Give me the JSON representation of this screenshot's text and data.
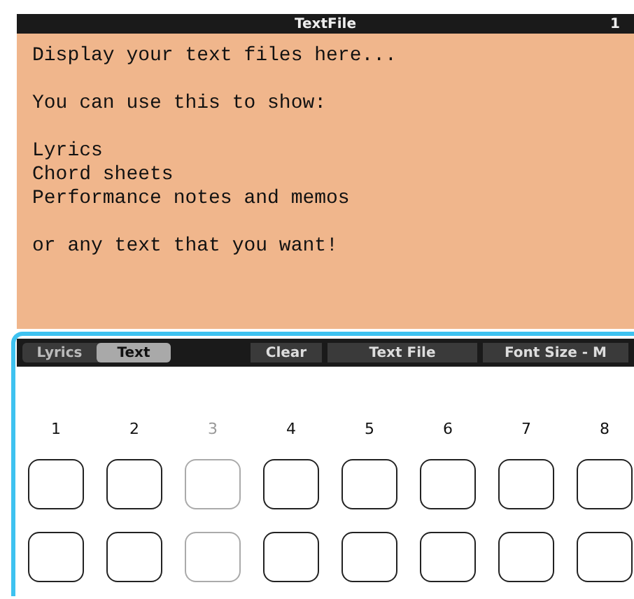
{
  "window": {
    "title": "TextFile",
    "page_number": "1"
  },
  "text_display": {
    "paragraphs": [
      [
        "Display your text files here..."
      ],
      [
        "You can use this to show:"
      ],
      [
        "Lyrics",
        "Chord sheets",
        "Performance notes and memos"
      ],
      [
        "or any text that you want!"
      ]
    ]
  },
  "tabs": [
    {
      "label": "Lyrics",
      "selected": false
    },
    {
      "label": "Text",
      "selected": true
    }
  ],
  "buttons": [
    "Clear",
    "Text File",
    "Font Size - M"
  ],
  "columns": [
    {
      "label": "1",
      "disabled": false
    },
    {
      "label": "2",
      "disabled": false
    },
    {
      "label": "3",
      "disabled": true
    },
    {
      "label": "4",
      "disabled": false
    },
    {
      "label": "5",
      "disabled": false
    },
    {
      "label": "6",
      "disabled": false
    },
    {
      "label": "7",
      "disabled": false
    },
    {
      "label": "8",
      "disabled": false
    }
  ]
}
